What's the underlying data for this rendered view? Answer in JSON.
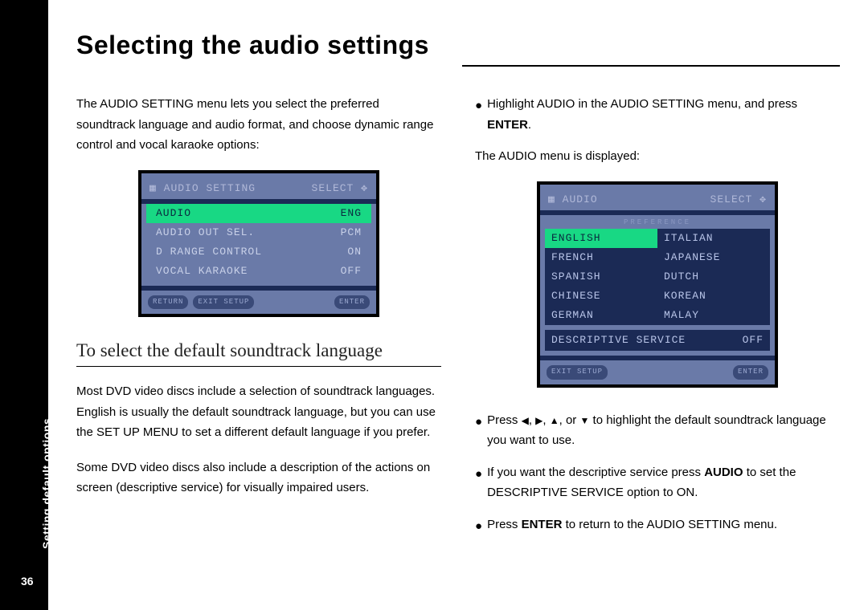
{
  "sidebar": {
    "label": "Setting default options",
    "page_number": "36"
  },
  "title": "Selecting the audio settings",
  "left": {
    "intro": "The AUDIO SETTING menu lets you select the preferred soundtrack language and audio format, and choose dynamic range control and vocal karaoke options:",
    "sub_heading": "To select the default soundtrack language",
    "para1": "Most DVD video discs include a selection of soundtrack languages. English is usually the default soundtrack language, but you can use the SET UP MENU to set a different default language if you prefer.",
    "para2": "Some DVD video discs also include a description of the actions on screen (descriptive service) for visually impaired users."
  },
  "right": {
    "b1_pre": "Highlight AUDIO in the AUDIO SETTING menu, and press ",
    "b1_bold": "ENTER",
    "b1_post": ".",
    "displayed": "The AUDIO menu is displayed:",
    "b2_pre": "Press ",
    "b2_post": " to highlight the default soundtrack language you want to use.",
    "b3_pre": "If you want the descriptive service press ",
    "b3_bold": "AUDIO",
    "b3_post": " to set the DESCRIPTIVE SERVICE option to ON.",
    "b4_pre": "Press ",
    "b4_bold": "ENTER",
    "b4_post": " to return to the AUDIO SETTING menu."
  },
  "osd1": {
    "title": "AUDIO SETTING",
    "select": "SELECT",
    "rows": [
      {
        "label": "AUDIO",
        "value": "ENG",
        "sel": true
      },
      {
        "label": "AUDIO OUT SEL.",
        "value": "PCM",
        "sel": false
      },
      {
        "label": "D RANGE CONTROL",
        "value": "ON",
        "sel": false
      },
      {
        "label": "VOCAL KARAOKE",
        "value": "OFF",
        "sel": false
      }
    ],
    "foot": [
      "RETURN",
      "EXIT SETUP",
      "ENTER"
    ]
  },
  "osd2": {
    "title": "AUDIO",
    "select": "SELECT",
    "pref": "PREFERENCE",
    "left_langs": [
      {
        "label": "ENGLISH",
        "sel": true
      },
      {
        "label": "FRENCH",
        "sel": false
      },
      {
        "label": "SPANISH",
        "sel": false
      },
      {
        "label": "CHINESE",
        "sel": false
      },
      {
        "label": "GERMAN",
        "sel": false
      }
    ],
    "right_langs": [
      {
        "label": "ITALIAN",
        "sel": false
      },
      {
        "label": "JAPANESE",
        "sel": false
      },
      {
        "label": "DUTCH",
        "sel": false
      },
      {
        "label": "KOREAN",
        "sel": false
      },
      {
        "label": "MALAY",
        "sel": false
      }
    ],
    "desc_label": "DESCRIPTIVE SERVICE",
    "desc_value": "OFF",
    "foot": [
      "EXIT SETUP",
      "ENTER"
    ]
  },
  "arrows": {
    "left": "◀",
    "right": "▶",
    "up": "▲",
    "down": "▼",
    "sep": ", ",
    "or": ", or "
  }
}
